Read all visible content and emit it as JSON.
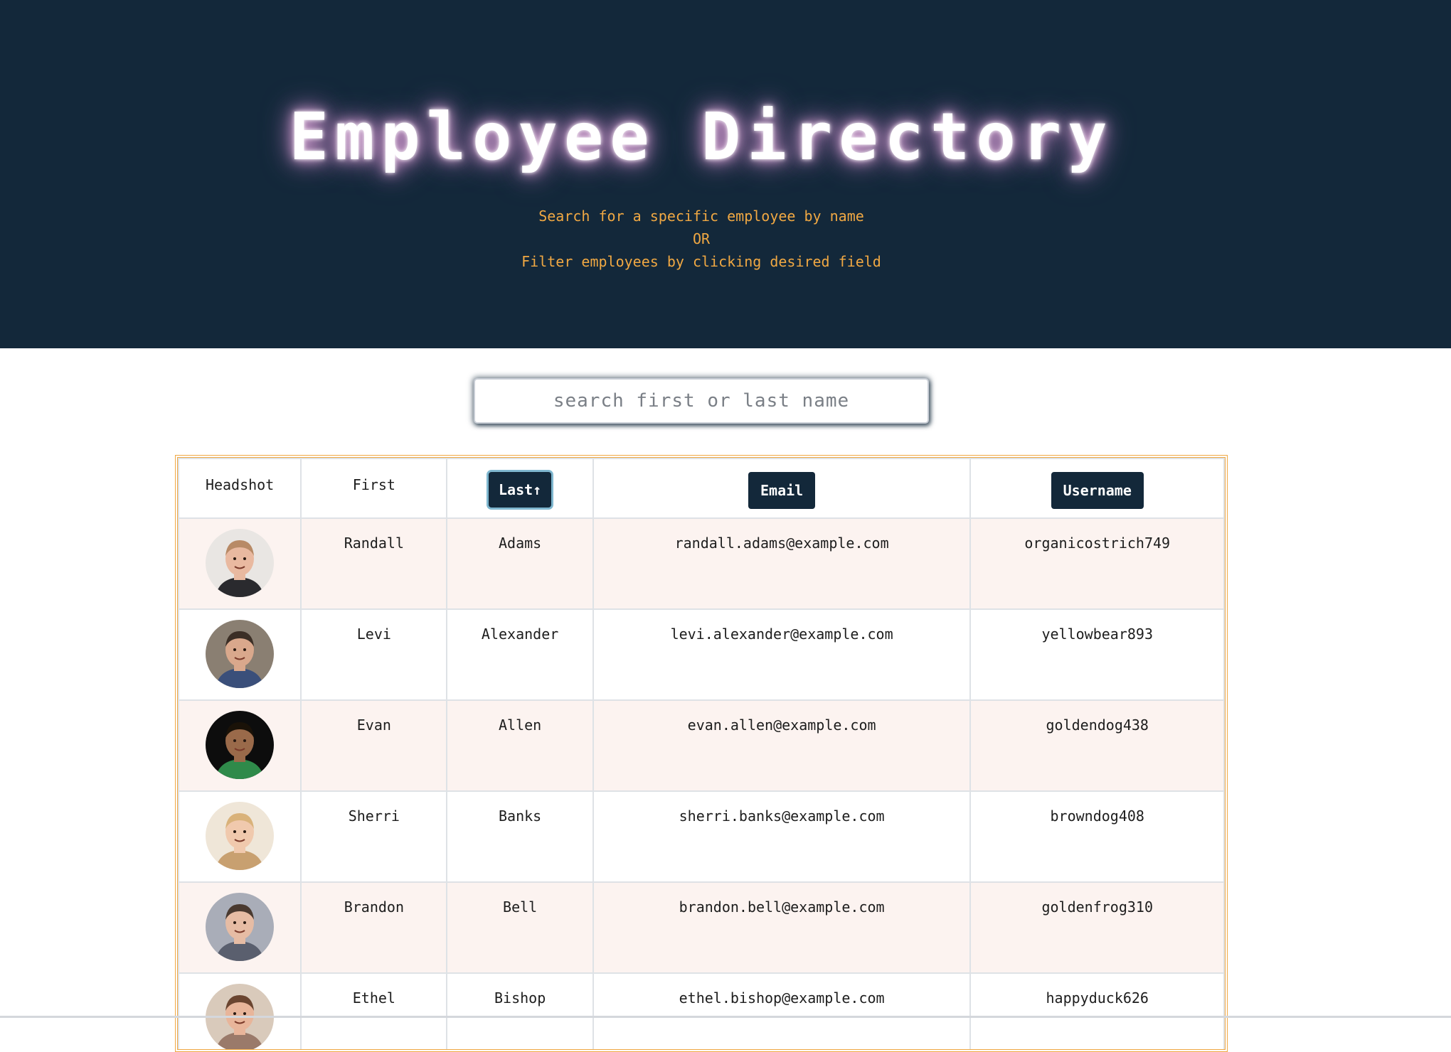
{
  "header": {
    "title": "Employee Directory",
    "subtitle_lines": [
      "Search for a specific employee by name",
      "OR",
      "Filter employees by clicking desired field"
    ]
  },
  "search": {
    "placeholder": "search first or last name",
    "value": ""
  },
  "table": {
    "columns": {
      "headshot": "Headshot",
      "first": "First",
      "last": "Last",
      "last_sort_indicator": "↑",
      "email": "Email",
      "username": "Username"
    },
    "rows": [
      {
        "first": "Randall",
        "last": "Adams",
        "email": "randall.adams@example.com",
        "username": "organicostrich749",
        "avatar": {
          "bg": "#e9e6e3",
          "skin": "#e9b9a0",
          "hair": "#b88a66",
          "shirt": "#2a2a2e"
        }
      },
      {
        "first": "Levi",
        "last": "Alexander",
        "email": "levi.alexander@example.com",
        "username": "yellowbear893",
        "avatar": {
          "bg": "#8a7f72",
          "skin": "#d9a88c",
          "hair": "#3b2e25",
          "shirt": "#3a4f7a"
        }
      },
      {
        "first": "Evan",
        "last": "Allen",
        "email": "evan.allen@example.com",
        "username": "goldendog438",
        "avatar": {
          "bg": "#0d0d0d",
          "skin": "#9a6a4a",
          "hair": "#1a1208",
          "shirt": "#2f8a4a"
        }
      },
      {
        "first": "Sherri",
        "last": "Banks",
        "email": "sherri.banks@example.com",
        "username": "browndog408",
        "avatar": {
          "bg": "#efe6d8",
          "skin": "#f0c9ad",
          "hair": "#d9b27a",
          "shirt": "#c8a070"
        }
      },
      {
        "first": "Brandon",
        "last": "Bell",
        "email": "brandon.bell@example.com",
        "username": "goldenfrog310",
        "avatar": {
          "bg": "#a9adb8",
          "skin": "#e6bca4",
          "hair": "#4a3a30",
          "shirt": "#5a5f6e"
        }
      },
      {
        "first": "Ethel",
        "last": "Bishop",
        "email": "ethel.bishop@example.com",
        "username": "happyduck626",
        "avatar": {
          "bg": "#d9cabb",
          "skin": "#e8b59a",
          "hair": "#6a4530",
          "shirt": "#9a7a6a"
        }
      }
    ]
  },
  "colors": {
    "header_bg": "#13283a",
    "accent": "#f0a843",
    "row_alt": "#fcf3f0",
    "button_bg": "#13283a"
  }
}
